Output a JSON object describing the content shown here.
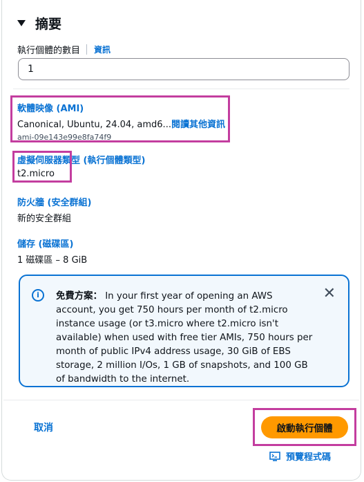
{
  "summary": {
    "title": "摘要",
    "instance_count_label": "執行個體的數目",
    "info_link": "資訊",
    "instance_count_value": "1"
  },
  "ami": {
    "title": "軟體映像 (AMI)",
    "value": "Canonical, Ubuntu, 24.04, amd6...",
    "more_link": "閱讀其他資訊",
    "id": "ami-09e143e99e8fa74f9"
  },
  "instance_type": {
    "title": "虛擬伺服器類型 (執行個體類型)",
    "value": "t2.micro"
  },
  "firewall": {
    "title": "防火牆 (安全群組)",
    "value": "新的安全群組"
  },
  "storage": {
    "title": "儲存 (磁碟區)",
    "value": "1 磁碟區 – 8 GiB"
  },
  "free_tier_alert": {
    "prefix": "免費方案：",
    "text": "In your first year of opening an AWS account, you get 750 hours per month of t2.micro instance usage (or t3.micro where t2.micro isn't available) when used with free tier AMIs, 750 hours per month of public IPv4 address usage, 30 GiB of EBS storage, 2 million I/Os, 1 GB of snapshots, and 100 GB of bandwidth to the internet."
  },
  "footer": {
    "cancel_label": "取消",
    "launch_label": "啟動執行個體",
    "preview_label": "預覽程式碼"
  },
  "colors": {
    "link": "#0972d3",
    "primary_button": "#ff9900",
    "annotation_box": "#c33d9f"
  }
}
